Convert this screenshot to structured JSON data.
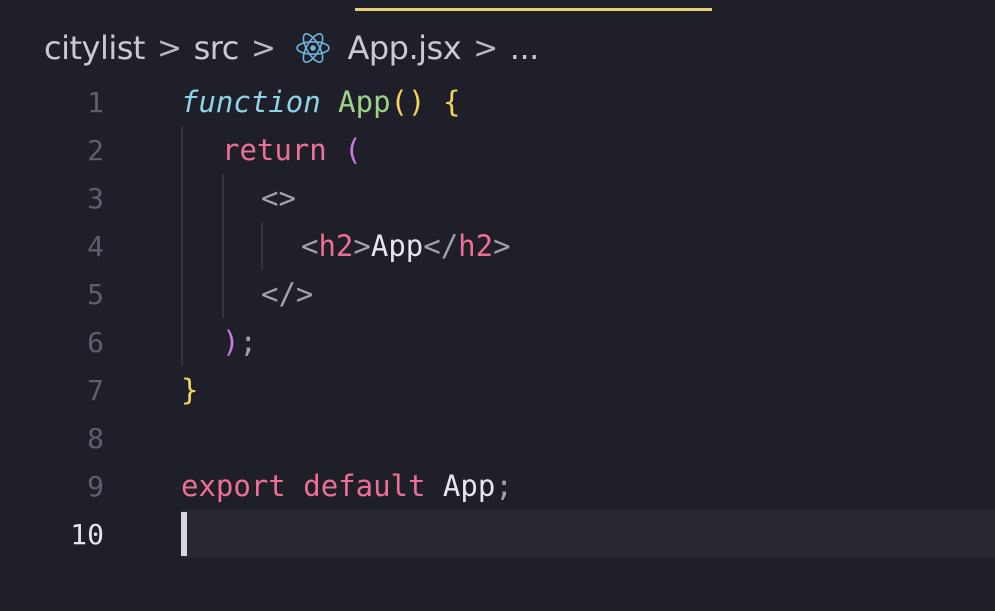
{
  "breadcrumb": {
    "items": [
      "citylist",
      "src",
      "App.jsx",
      "..."
    ],
    "separator": ">",
    "file_icon": "react-icon"
  },
  "editor": {
    "active_line": 10,
    "lines": [
      {
        "number": "1",
        "tokens": [
          "function",
          " ",
          "App",
          "(",
          ")",
          " ",
          "{"
        ]
      },
      {
        "number": "2",
        "tokens": [
          "return",
          " ",
          "("
        ]
      },
      {
        "number": "3",
        "tokens": [
          "<>"
        ]
      },
      {
        "number": "4",
        "tokens": [
          "<",
          "h2",
          ">",
          "App",
          "</",
          "h2",
          ">"
        ]
      },
      {
        "number": "5",
        "tokens": [
          "</>"
        ]
      },
      {
        "number": "6",
        "tokens": [
          ")",
          ";"
        ]
      },
      {
        "number": "7",
        "tokens": [
          "}"
        ]
      },
      {
        "number": "8",
        "tokens": []
      },
      {
        "number": "9",
        "tokens": [
          "export",
          " ",
          "default",
          " ",
          "App",
          ";"
        ]
      },
      {
        "number": "10",
        "tokens": []
      }
    ]
  },
  "colors": {
    "background": "#1e1f28",
    "tab_indicator": "#e3d074",
    "keyword": "#ee6f95",
    "function_keyword": "#8fd3e8",
    "function_name": "#9ed28a",
    "bracket_yellow": "#f4d35e",
    "bracket_purple": "#c67ae3"
  }
}
